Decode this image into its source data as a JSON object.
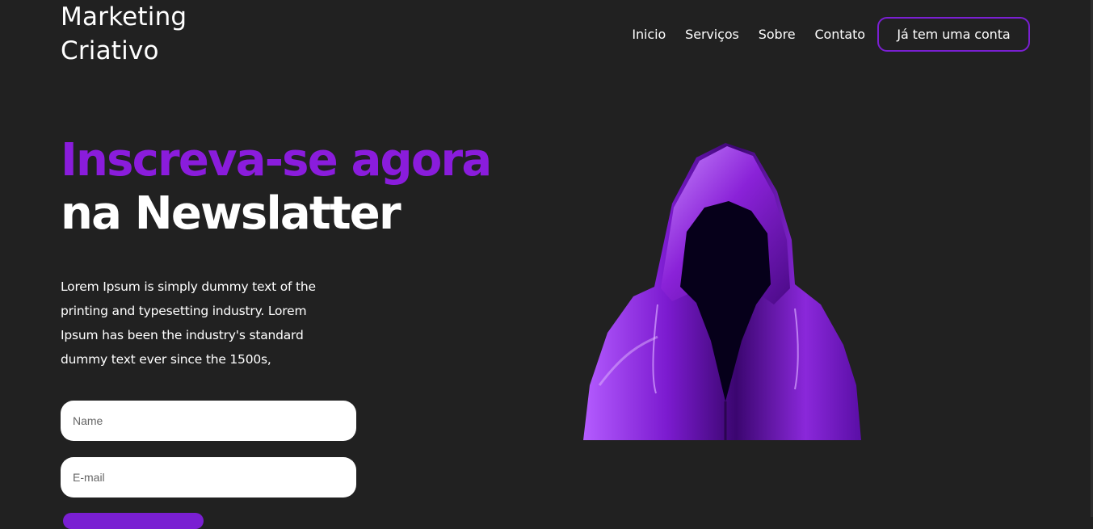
{
  "brand": {
    "line1": "Marketing",
    "line2": "Criativo"
  },
  "nav": {
    "items": [
      "Inicio",
      "Serviços",
      "Sobre",
      "Contato"
    ],
    "account_button": "Já tem uma conta"
  },
  "hero": {
    "headline_accent": "Inscreva-se agora",
    "headline_main": "na Newslatter",
    "description": "Lorem Ipsum is simply dummy text of the printing and typesetting industry. Lorem Ipsum has been the industry's standard dummy text ever since the 1500s,"
  },
  "form": {
    "name_placeholder": "Name",
    "email_placeholder": "E-mail"
  },
  "colors": {
    "background": "#212121",
    "accent": "#8a1cdc",
    "text": "#ffffff"
  }
}
